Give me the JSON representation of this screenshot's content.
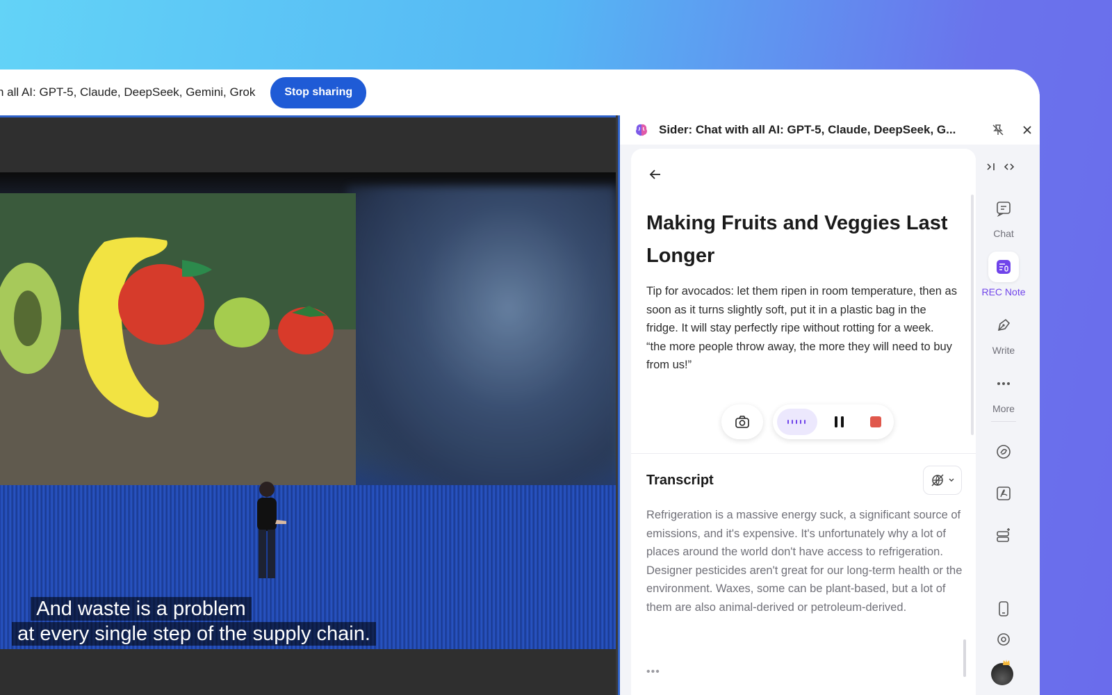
{
  "share_bar": {
    "text": "h all AI: GPT-5, Claude, DeepSeek, Gemini, Grok",
    "stop_label": "Stop sharing"
  },
  "video": {
    "subtitle_line1": "And waste is a problem",
    "subtitle_line2": "at every single step of the supply chain."
  },
  "panel": {
    "title": "Sider: Chat with all AI: GPT-5, Claude, DeepSeek, G...",
    "note": {
      "title": "Making Fruits and Veggies Last Longer",
      "body_line1": "Tip for avocados: let them ripen in room temperature, then as soon as it turns slightly soft, put it in a plastic bag in the fridge. It will stay perfectly ripe without rotting for a week.",
      "body_line2": "“the more people throw away, the more they will need to buy from us!”"
    },
    "transcript": {
      "label": "Transcript",
      "paragraph1": "Refrigeration is a massive energy suck, a significant source of emissions, and it's expensive. It's unfortunately why a lot of places around the world don't have access to refrigeration.",
      "paragraph2": "Designer pesticides aren't great for our long-term health or the environment. Waxes, some can be plant-based, but a lot of them are also animal-derived or petroleum-derived.",
      "more": "•••"
    }
  },
  "rail": {
    "items": [
      {
        "label": "Chat",
        "icon": "chat-icon"
      },
      {
        "label": "REC Note",
        "icon": "rec-note-icon",
        "active": true
      },
      {
        "label": "Write",
        "icon": "write-icon"
      },
      {
        "label": "More",
        "icon": "more-icon"
      }
    ]
  },
  "colors": {
    "accent": "#7044ea",
    "share_button": "#1f5bd6",
    "record_stop": "#e0584c"
  }
}
